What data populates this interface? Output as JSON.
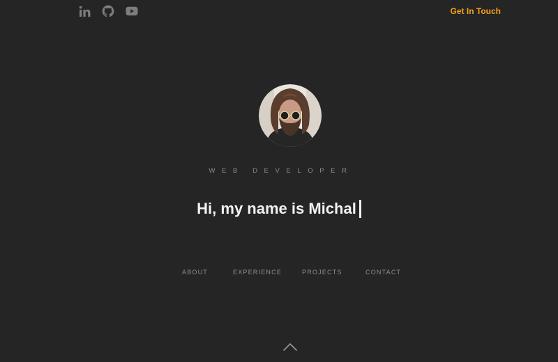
{
  "header": {
    "socials": [
      {
        "icon": "linkedin-icon"
      },
      {
        "icon": "github-icon"
      },
      {
        "icon": "youtube-icon"
      }
    ],
    "cta_label": "Get In Touch"
  },
  "hero": {
    "role": "WEB DEVELOPER",
    "headline": "Hi, my name is Michal"
  },
  "nav": {
    "items": [
      {
        "label": "ABOUT"
      },
      {
        "label": "EXPERIENCE"
      },
      {
        "label": "PROJECTS"
      },
      {
        "label": "CONTACT"
      }
    ]
  },
  "colors": {
    "background": "#252525",
    "accent": "#f5a21c",
    "muted_text": "#8d8d8d",
    "headline": "#f2f2f2"
  }
}
